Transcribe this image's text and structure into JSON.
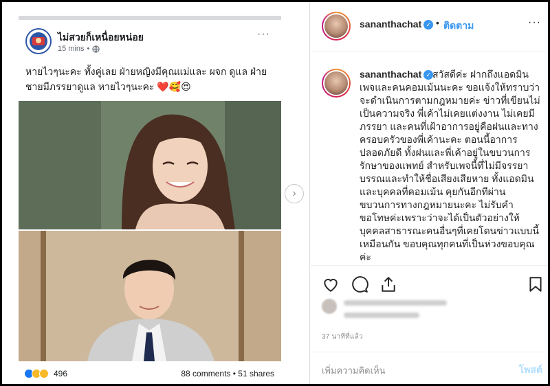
{
  "fb_post": {
    "page_name": "ไม่สวยก็เหนื่อยหน่อย",
    "time": "15 mins",
    "more": "···",
    "text": "หายไวๆนะคะ ทั้งคู่เลย ฝ่ายหญิงมีคุณแม่และ ผจก ดูแล ฝ่ายชายมีภรรยาดูแล หายไวๆนะคะ ❤️🥰😍",
    "reactions_count": "496",
    "comments": "88 comments",
    "shares": "51 shares",
    "separator": "•"
  },
  "carousel": {
    "next_label": "›"
  },
  "instagram": {
    "username": "sananthachat",
    "verified_mark": "✓",
    "dot": "•",
    "follow_label": "ติดตาม",
    "more": "···",
    "caption_user": "sananthachat",
    "caption": "สวัสดีค่ะ ฝากถึงแอดมินเพจและคนคอมเม้นนะคะ ขอแจ้งให้ทราบว่าจะดำเนินการตามกฎหมายค่ะ ข่าวที่เขียนไม่เป็นความจริง พี่เค้าไม่เคยแต่งงาน ไม่เคยมีภรรยา และคนที่เฝ้าอาการอยู่คือฝนและทางครอบครัวของพี่เค้านะคะ ตอนนี้อาการปลอดภัยดี ทั้งฝนและพี่เค้าอยู่ในขบวนการรักษาของแพทย์ สำหรับเพจนี้ที่ไม่มีจรรยาบรรณและทำให้ชื่อเสียงเสียหาย ทั้งแอดมินและบุคคลที่คอมเม้น คุยกันอีกทีผ่านขบวนการทางกฎหมายนะคะ ไม่รับคำขอโทษค่ะเพราะว่าจะได้เป็นตัวอย่างให้บุคคลสาธารณะคนอื่นๆที่เคยโดนข่าวแบบนี้เหมือนกัน ขอบคุณทุกคนที่เป็นห่วงขอบคุณค่ะ",
    "time_ago": "37 นาทีที่แล้ว",
    "comment_placeholder": "เพิ่มความคิดเห็น",
    "post_label": "โพสต์"
  },
  "colors": {
    "ig_blue": "#3897f0",
    "ig_post_disabled": "#b2dffc",
    "fb_text": "#1c1e21",
    "heart_red": "#e0245e"
  }
}
